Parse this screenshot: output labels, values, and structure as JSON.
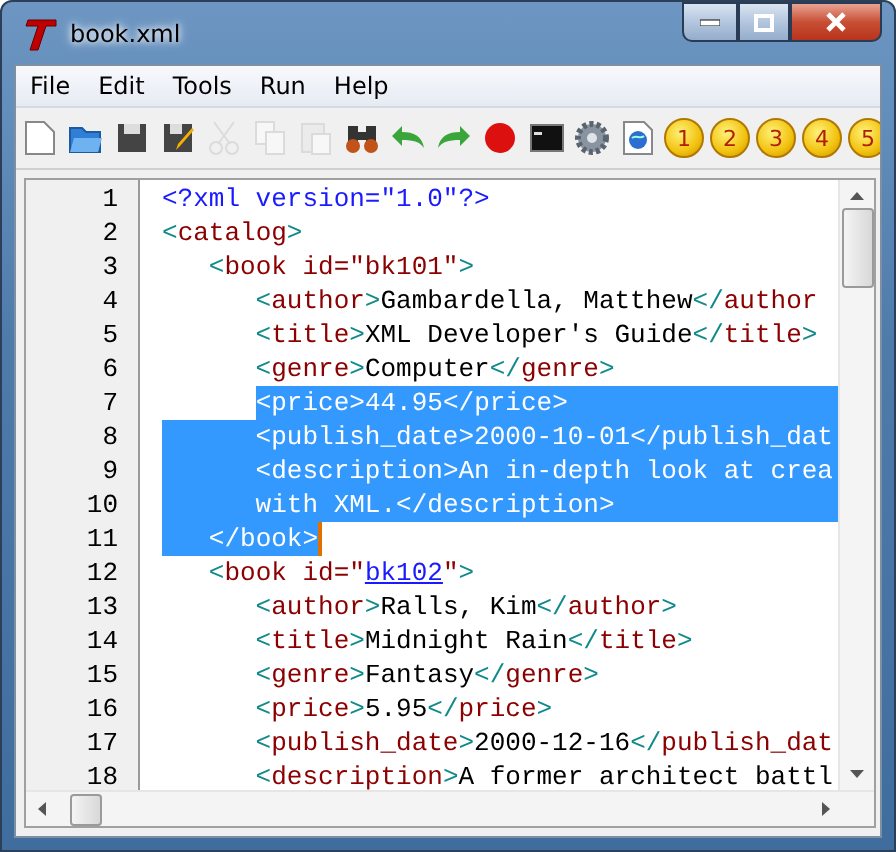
{
  "window": {
    "title": "book.xml"
  },
  "menu": [
    "File",
    "Edit",
    "Tools",
    "Run",
    "Help"
  ],
  "toolbar": [
    {
      "kind": "new",
      "disabled": false
    },
    {
      "kind": "open",
      "disabled": false
    },
    {
      "kind": "save",
      "disabled": false
    },
    {
      "kind": "save-as",
      "disabled": false
    },
    {
      "kind": "cut",
      "disabled": true
    },
    {
      "kind": "copy",
      "disabled": true
    },
    {
      "kind": "paste",
      "disabled": true
    },
    {
      "kind": "find",
      "disabled": false
    },
    {
      "kind": "undo",
      "disabled": false
    },
    {
      "kind": "redo",
      "disabled": false
    },
    {
      "kind": "record",
      "disabled": false
    },
    {
      "kind": "terminal",
      "disabled": false
    },
    {
      "kind": "gear",
      "disabled": false
    },
    {
      "kind": "browser",
      "disabled": false
    },
    {
      "kind": "number",
      "label": "1",
      "disabled": false
    },
    {
      "kind": "number",
      "label": "2",
      "disabled": false
    },
    {
      "kind": "number",
      "label": "3",
      "disabled": false
    },
    {
      "kind": "number",
      "label": "4",
      "disabled": false
    },
    {
      "kind": "number",
      "label": "5",
      "disabled": false
    }
  ],
  "editor": {
    "lines": [
      {
        "number": "1",
        "selected": false,
        "tokens": [
          {
            "kind": "pi",
            "text": "<?xml version=\"1.0\"?>"
          }
        ]
      },
      {
        "number": "2",
        "selected": false,
        "tokens": [
          {
            "kind": "bracket",
            "text": "<"
          },
          {
            "kind": "tag",
            "text": "catalog"
          },
          {
            "kind": "bracket",
            "text": ">"
          }
        ]
      },
      {
        "number": "3",
        "selected": false,
        "tokens": [
          {
            "kind": "bracket",
            "text": "   <"
          },
          {
            "kind": "tag",
            "text": "book id=\"bk101\""
          },
          {
            "kind": "bracket",
            "text": ">"
          }
        ]
      },
      {
        "number": "4",
        "selected": false,
        "tokens": [
          {
            "kind": "bracket",
            "text": "      <"
          },
          {
            "kind": "tag",
            "text": "author"
          },
          {
            "kind": "bracket",
            "text": ">"
          },
          {
            "kind": "text",
            "text": "Gambardella, Matthew"
          },
          {
            "kind": "bracket",
            "text": "</"
          },
          {
            "kind": "tag",
            "text": "author"
          }
        ]
      },
      {
        "number": "5",
        "selected": false,
        "tokens": [
          {
            "kind": "bracket",
            "text": "      <"
          },
          {
            "kind": "tag",
            "text": "title"
          },
          {
            "kind": "bracket",
            "text": ">"
          },
          {
            "kind": "text",
            "text": "XML Developer's Guide"
          },
          {
            "kind": "bracket",
            "text": "</"
          },
          {
            "kind": "tag",
            "text": "title"
          },
          {
            "kind": "bracket",
            "text": ">"
          }
        ]
      },
      {
        "number": "6",
        "selected": false,
        "tokens": [
          {
            "kind": "bracket",
            "text": "      <"
          },
          {
            "kind": "tag",
            "text": "genre"
          },
          {
            "kind": "bracket",
            "text": ">"
          },
          {
            "kind": "text",
            "text": "Computer"
          },
          {
            "kind": "bracket",
            "text": "</"
          },
          {
            "kind": "tag",
            "text": "genre"
          },
          {
            "kind": "bracket",
            "text": ">"
          }
        ]
      },
      {
        "number": "7",
        "selected": true,
        "starts_at_text": true,
        "tokens": [
          {
            "kind": "bracket",
            "text": "      <"
          },
          {
            "kind": "tag",
            "text": "price"
          },
          {
            "kind": "bracket",
            "text": ">"
          },
          {
            "kind": "text",
            "text": "44.95"
          },
          {
            "kind": "bracket",
            "text": "</"
          },
          {
            "kind": "tag",
            "text": "price"
          },
          {
            "kind": "bracket",
            "text": ">"
          }
        ]
      },
      {
        "number": "8",
        "selected": true,
        "tokens": [
          {
            "kind": "bracket",
            "text": "      <"
          },
          {
            "kind": "tag",
            "text": "publish_date"
          },
          {
            "kind": "bracket",
            "text": ">"
          },
          {
            "kind": "text",
            "text": "2000-10-01"
          },
          {
            "kind": "bracket",
            "text": "</"
          },
          {
            "kind": "tag",
            "text": "publish_dat"
          }
        ]
      },
      {
        "number": "9",
        "selected": true,
        "tokens": [
          {
            "kind": "bracket",
            "text": "      <"
          },
          {
            "kind": "tag",
            "text": "description"
          },
          {
            "kind": "bracket",
            "text": ">"
          },
          {
            "kind": "text",
            "text": "An in-depth look at crea"
          }
        ]
      },
      {
        "number": "10",
        "selected": true,
        "tokens": [
          {
            "kind": "text",
            "text": "      with XML."
          },
          {
            "kind": "bracket",
            "text": "</"
          },
          {
            "kind": "tag",
            "text": "description"
          },
          {
            "kind": "bracket",
            "text": ">"
          }
        ]
      },
      {
        "number": "11",
        "selected": true,
        "ends_at_text": true,
        "cursor": true,
        "tokens": [
          {
            "kind": "bracket",
            "text": "   </"
          },
          {
            "kind": "tag",
            "text": "book"
          },
          {
            "kind": "bracket",
            "text": ">"
          }
        ]
      },
      {
        "number": "12",
        "selected": false,
        "tokens": [
          {
            "kind": "bracket",
            "text": "   <"
          },
          {
            "kind": "tag",
            "text": "book id=\""
          },
          {
            "kind": "match",
            "text": "bk102"
          },
          {
            "kind": "tag",
            "text": "\""
          },
          {
            "kind": "bracket",
            "text": ">"
          }
        ]
      },
      {
        "number": "13",
        "selected": false,
        "tokens": [
          {
            "kind": "bracket",
            "text": "      <"
          },
          {
            "kind": "tag",
            "text": "author"
          },
          {
            "kind": "bracket",
            "text": ">"
          },
          {
            "kind": "text",
            "text": "Ralls, Kim"
          },
          {
            "kind": "bracket",
            "text": "</"
          },
          {
            "kind": "tag",
            "text": "author"
          },
          {
            "kind": "bracket",
            "text": ">"
          }
        ]
      },
      {
        "number": "14",
        "selected": false,
        "tokens": [
          {
            "kind": "bracket",
            "text": "      <"
          },
          {
            "kind": "tag",
            "text": "title"
          },
          {
            "kind": "bracket",
            "text": ">"
          },
          {
            "kind": "text",
            "text": "Midnight Rain"
          },
          {
            "kind": "bracket",
            "text": "</"
          },
          {
            "kind": "tag",
            "text": "title"
          },
          {
            "kind": "bracket",
            "text": ">"
          }
        ]
      },
      {
        "number": "15",
        "selected": false,
        "tokens": [
          {
            "kind": "bracket",
            "text": "      <"
          },
          {
            "kind": "tag",
            "text": "genre"
          },
          {
            "kind": "bracket",
            "text": ">"
          },
          {
            "kind": "text",
            "text": "Fantasy"
          },
          {
            "kind": "bracket",
            "text": "</"
          },
          {
            "kind": "tag",
            "text": "genre"
          },
          {
            "kind": "bracket",
            "text": ">"
          }
        ]
      },
      {
        "number": "16",
        "selected": false,
        "tokens": [
          {
            "kind": "bracket",
            "text": "      <"
          },
          {
            "kind": "tag",
            "text": "price"
          },
          {
            "kind": "bracket",
            "text": ">"
          },
          {
            "kind": "text",
            "text": "5.95"
          },
          {
            "kind": "bracket",
            "text": "</"
          },
          {
            "kind": "tag",
            "text": "price"
          },
          {
            "kind": "bracket",
            "text": ">"
          }
        ]
      },
      {
        "number": "17",
        "selected": false,
        "tokens": [
          {
            "kind": "bracket",
            "text": "      <"
          },
          {
            "kind": "tag",
            "text": "publish_date"
          },
          {
            "kind": "bracket",
            "text": ">"
          },
          {
            "kind": "text",
            "text": "2000-12-16"
          },
          {
            "kind": "bracket",
            "text": "</"
          },
          {
            "kind": "tag",
            "text": "publish_dat"
          }
        ]
      },
      {
        "number": "18",
        "selected": false,
        "tokens": [
          {
            "kind": "bracket",
            "text": "      <"
          },
          {
            "kind": "tag",
            "text": "description"
          },
          {
            "kind": "bracket",
            "text": ">"
          },
          {
            "kind": "text",
            "text": "A former architect battl"
          }
        ]
      }
    ]
  }
}
